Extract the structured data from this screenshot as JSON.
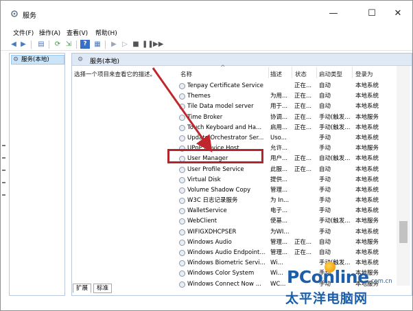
{
  "window": {
    "title": "服务",
    "minimize": "—",
    "maximize": "☐",
    "close": "✕"
  },
  "menu": [
    "文件(F)",
    "操作(A)",
    "查看(V)",
    "帮助(H)"
  ],
  "toolbar": {
    "buttons": [
      "back-icon",
      "forward-icon",
      "console-tree-icon",
      "refresh-icon",
      "export-icon",
      "help-icon",
      "properties-icon",
      "play-icon",
      "play-alt-icon",
      "stop-icon",
      "pause-icon",
      "restart-icon"
    ]
  },
  "tree": {
    "root_label": "服务(本地)"
  },
  "main": {
    "header": "服务(本地)",
    "description_hint": "选择一个项目来查看它的描述。",
    "columns": [
      "名称",
      "描述",
      "状态",
      "启动类型",
      "登录为"
    ],
    "services": [
      {
        "name": "Tenpay Certificate Service",
        "desc": "",
        "status": "正在...",
        "startup": "自动",
        "logon": "本地系统"
      },
      {
        "name": "Themes",
        "desc": "为用...",
        "status": "正在...",
        "startup": "自动",
        "logon": "本地系统"
      },
      {
        "name": "Tile Data model server",
        "desc": "用于...",
        "status": "正在...",
        "startup": "自动",
        "logon": "本地系统"
      },
      {
        "name": "Time Broker",
        "desc": "协调...",
        "status": "正在...",
        "startup": "手动(触发...",
        "logon": "本地服务"
      },
      {
        "name": "Touch Keyboard and Ha...",
        "desc": "启用...",
        "status": "正在...",
        "startup": "手动(触发...",
        "logon": "本地系统"
      },
      {
        "name": "Update Orchestrator Ser...",
        "desc": "Uso...",
        "status": "",
        "startup": "手动",
        "logon": "本地系统"
      },
      {
        "name": "UPnP Device Host",
        "desc": "允许...",
        "status": "",
        "startup": "手动",
        "logon": "本地服务"
      },
      {
        "name": "User Manager",
        "desc": "用户...",
        "status": "正在...",
        "startup": "自动(触发...",
        "logon": "本地系统"
      },
      {
        "name": "User Profile Service",
        "desc": "此服...",
        "status": "正在...",
        "startup": "自动",
        "logon": "本地系统"
      },
      {
        "name": "Virtual Disk",
        "desc": "提供...",
        "status": "",
        "startup": "手动",
        "logon": "本地系统"
      },
      {
        "name": "Volume Shadow Copy",
        "desc": "管理...",
        "status": "",
        "startup": "手动",
        "logon": "本地系统"
      },
      {
        "name": "W3C 日志记录服务",
        "desc": "为 In...",
        "status": "",
        "startup": "手动",
        "logon": "本地系统"
      },
      {
        "name": "WalletService",
        "desc": "电子...",
        "status": "",
        "startup": "手动",
        "logon": "本地系统"
      },
      {
        "name": "WebClient",
        "desc": "使基...",
        "status": "",
        "startup": "手动(触发...",
        "logon": "本地服务"
      },
      {
        "name": "WIFIGXDHCPSER",
        "desc": "为WI...",
        "status": "",
        "startup": "手动",
        "logon": "本地系统"
      },
      {
        "name": "Windows Audio",
        "desc": "管理...",
        "status": "正在...",
        "startup": "自动",
        "logon": "本地服务"
      },
      {
        "name": "Windows Audio Endpoint...",
        "desc": "管理...",
        "status": "正在...",
        "startup": "自动",
        "logon": "本地系统"
      },
      {
        "name": "Windows Biometric Servi...",
        "desc": "Wi...",
        "status": "",
        "startup": "手动(触发...",
        "logon": "本地系统"
      },
      {
        "name": "Windows Color System",
        "desc": "Wi...",
        "status": "",
        "startup": "手动",
        "logon": "本地服务"
      },
      {
        "name": "Windows Connect Now ...",
        "desc": "WC...",
        "status": "",
        "startup": "手动",
        "logon": "本地服务"
      }
    ]
  },
  "tabs": [
    "扩展",
    "标准"
  ],
  "watermark": {
    "brand": "PConline",
    "domain": ".com.cn",
    "subtitle": "太平洋电脑网"
  },
  "colors": {
    "highlight": "#b3252b",
    "selection": "#cce4f7",
    "header_bg": "#dfe8f5",
    "brand": "#1c5fa8"
  }
}
